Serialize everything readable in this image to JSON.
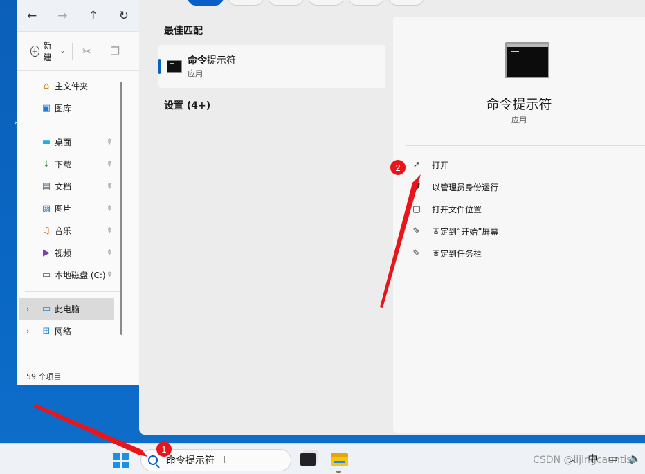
{
  "explorer": {
    "new_label": "新建",
    "quick_items": [
      {
        "label": "主文件夹",
        "icon": "home-icon"
      },
      {
        "label": "图库",
        "icon": "gallery-icon"
      }
    ],
    "pinned_items": [
      {
        "label": "桌面",
        "icon": "desktop-icon"
      },
      {
        "label": "下载",
        "icon": "download-icon"
      },
      {
        "label": "文档",
        "icon": "document-icon"
      },
      {
        "label": "图片",
        "icon": "pictures-icon"
      },
      {
        "label": "音乐",
        "icon": "music-icon"
      },
      {
        "label": "视频",
        "icon": "video-icon"
      },
      {
        "label": "本地磁盘 (C:)",
        "icon": "drive-icon"
      }
    ],
    "tree_items": [
      {
        "label": "此电脑",
        "icon": "computer-icon",
        "selected": true
      },
      {
        "label": "网络",
        "icon": "network-icon",
        "selected": false
      }
    ],
    "status": "59 个项目"
  },
  "search": {
    "best_match_heading": "最佳匹配",
    "best_match": {
      "name_bold": "命令",
      "name_rest": "提示符",
      "type": "应用"
    },
    "settings_heading": "设置 (4+)",
    "detail": {
      "app_name": "命令提示符",
      "app_type": "应用",
      "actions": [
        {
          "label": "打开",
          "icon": "open-external-icon"
        },
        {
          "label": "以管理员身份运行",
          "icon": "shield-icon"
        },
        {
          "label": "打开文件位置",
          "icon": "folder-icon"
        },
        {
          "label": "固定到“开始”屏幕",
          "icon": "pin-icon"
        },
        {
          "label": "固定到任务栏",
          "icon": "pin-icon"
        }
      ]
    }
  },
  "taskbar": {
    "search_value": "命令提示符",
    "tray": {
      "ime": "中"
    }
  },
  "annotations": {
    "badge_1": "1",
    "badge_2": "2",
    "color": "#e8161b"
  },
  "watermark": "CSDN @lijingcauntist",
  "colors": {
    "accent": "#0a5ec7",
    "desktop": "#0b5fb8"
  }
}
